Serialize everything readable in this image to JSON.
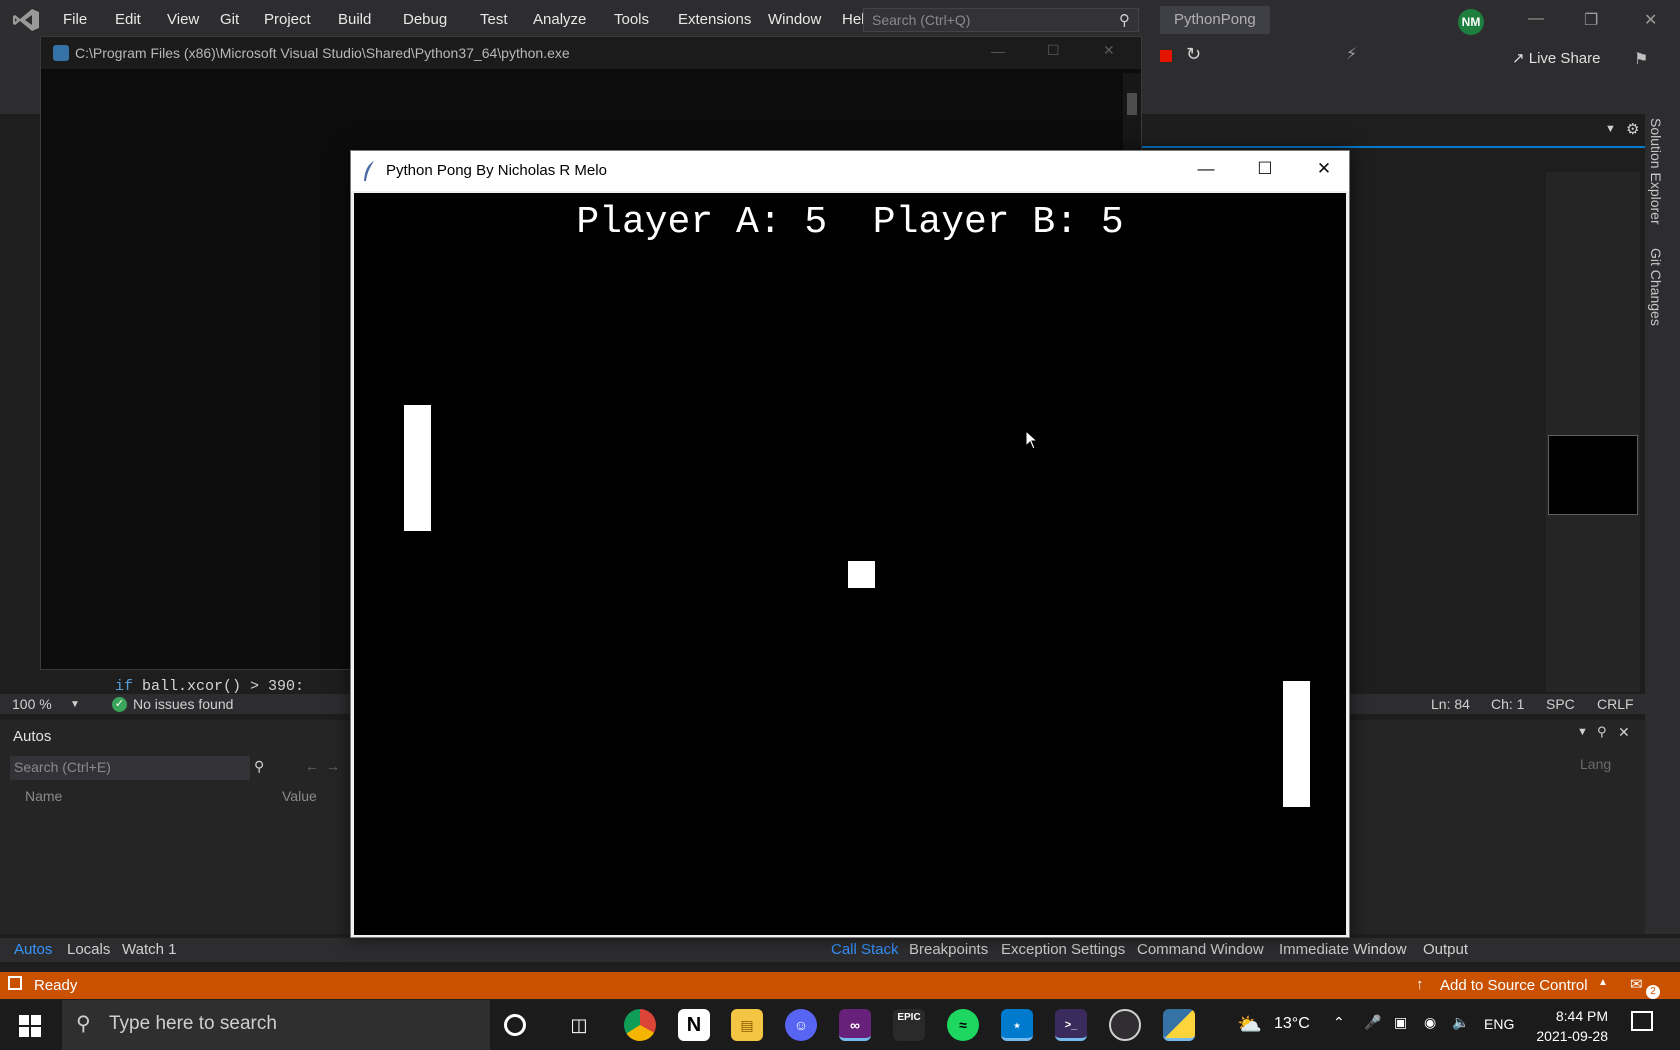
{
  "vs": {
    "menu": [
      "File",
      "Edit",
      "View",
      "Git",
      "Project",
      "Build",
      "Debug",
      "Test",
      "Analyze",
      "Tools",
      "Extensions",
      "Window",
      "Help"
    ],
    "search_placeholder": "Search (Ctrl+Q)",
    "project_name": "PythonPong",
    "user_initials": "NM",
    "live_share": "Live Share",
    "side_tabs": [
      "Solution Explorer",
      "Git Changes"
    ]
  },
  "console": {
    "title": "C:\\Program Files (x86)\\Microsoft Visual Studio\\Shared\\Python37_64\\python.exe"
  },
  "editor": {
    "code_keyword": "if",
    "code_rest": " ball.xcor() > 390:",
    "zoom": "100 %",
    "issues": "No issues found",
    "line": "Ln: 84",
    "col": "Ch: 1",
    "spacing": "SPC",
    "line_ending": "CRLF"
  },
  "autos": {
    "title": "Autos",
    "search_placeholder": "Search (Ctrl+E)",
    "col_name": "Name",
    "col_value": "Value",
    "right_col": "Lang"
  },
  "bottom_tabs_left": [
    "Autos",
    "Locals",
    "Watch 1"
  ],
  "bottom_tabs_right": [
    "Call Stack",
    "Breakpoints",
    "Exception Settings",
    "Command Window",
    "Immediate Window",
    "Output"
  ],
  "status": {
    "ready": "Ready",
    "source_control": "Add to Source Control",
    "notifications": "2"
  },
  "taskbar": {
    "search_placeholder": "Type here to search",
    "weather": "13°C",
    "language": "ENG",
    "time": "8:44 PM",
    "date": "2021-09-28",
    "apps": [
      "Cortana",
      "Task View",
      "Chrome",
      "Notion",
      "File Explorer",
      "Discord",
      "Visual Studio",
      "Epic Games",
      "Spotify",
      "VS Code",
      "Terminal",
      "OBS",
      "Python"
    ]
  },
  "pong": {
    "window_title": "Python Pong By Nicholas R Melo",
    "score_text": "Player A: 5  Player B: 5",
    "player_a_score": 5,
    "player_b_score": 5
  },
  "colors": {
    "vs_chrome": "#2d2d30",
    "status_orange": "#ca5100",
    "accent_blue": "#3794ff"
  }
}
